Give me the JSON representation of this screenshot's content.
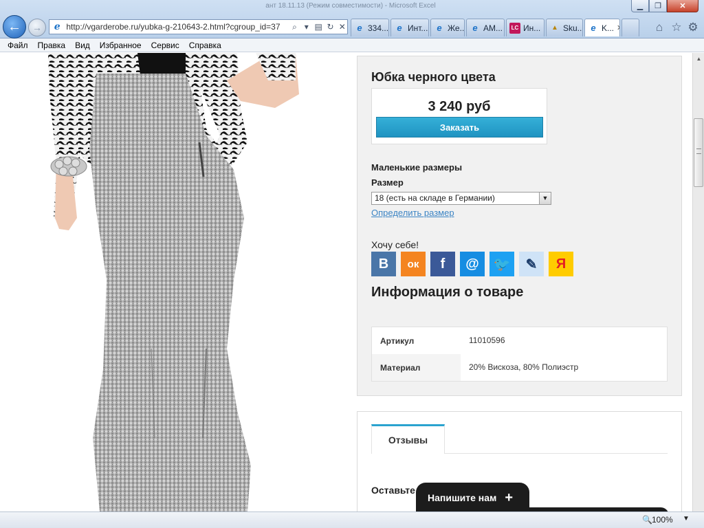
{
  "window": {
    "title": "ант 18.11.13 (Режим совместимости) - Microsoft Excel",
    "minimize": "▁",
    "maximize": "❐",
    "close": "✕"
  },
  "nav": {
    "back": "←",
    "forward": "→"
  },
  "address": {
    "url": "http://vgarderobe.ru/yubka-g-210643-2.html?cgroup_id=37",
    "search_icon": "⌕",
    "dropdown_icon": "▾",
    "compat_icon": "▤",
    "refresh_icon": "↻",
    "stop_icon": "✕"
  },
  "tabs": [
    {
      "label": "334...",
      "icon": "ie",
      "color": "#1d73c8",
      "active": false
    },
    {
      "label": "Инт...",
      "icon": "ie",
      "color": "#1d73c8",
      "active": false
    },
    {
      "label": "Же...",
      "icon": "ie",
      "color": "#1d73c8",
      "active": false
    },
    {
      "label": "AM...",
      "icon": "ie",
      "color": "#1d73c8",
      "active": false
    },
    {
      "label": "Ин...",
      "icon": "LC",
      "color": "#c2185b",
      "active": false
    },
    {
      "label": "Sku...",
      "icon": "sku",
      "color": "#b8860b",
      "active": false
    },
    {
      "label": "K...",
      "icon": "ie",
      "color": "#1d73c8",
      "active": true
    }
  ],
  "toolbar": {
    "home": "⌂",
    "favorites": "☆",
    "tools": "⚙"
  },
  "menu": [
    "Файл",
    "Правка",
    "Вид",
    "Избранное",
    "Сервис",
    "Справка"
  ],
  "product": {
    "title": "Юбка черного цвета",
    "price": "3 240 руб",
    "order_label": "Заказать",
    "size_group": "Маленькие размеры",
    "size_label": "Размер",
    "size_selected": "18 (есть на складе в Германии)",
    "size_guide": "Определить размер",
    "want_label": "Хочу себе!",
    "social": [
      {
        "name": "vk",
        "glyph": "В",
        "color": "#4a76a8"
      },
      {
        "name": "odnoklassniki",
        "glyph": "ок",
        "color": "#f48420"
      },
      {
        "name": "facebook",
        "glyph": "f",
        "color": "#3b5998"
      },
      {
        "name": "mailru",
        "glyph": "@",
        "color": "#168de2"
      },
      {
        "name": "twitter",
        "glyph": "🐦",
        "color": "#1da1f2"
      },
      {
        "name": "livejournal",
        "glyph": "✎",
        "color": "#cfe3f7"
      },
      {
        "name": "yandex",
        "glyph": "Я",
        "color": "#ffcc00"
      }
    ],
    "info_heading": "Информация о товаре",
    "specs": [
      {
        "key": "Артикул",
        "value": "11010596"
      },
      {
        "key": "Материал",
        "value": "20% Вискоза, 80% Полиэстр"
      }
    ]
  },
  "reviews": {
    "tab_label": "Отзывы",
    "leave_label": "Оставьте"
  },
  "chat": {
    "label": "Напишите нам",
    "plus": "+"
  },
  "status": {
    "zoom": "100%",
    "zoom_arrow": "▼"
  }
}
